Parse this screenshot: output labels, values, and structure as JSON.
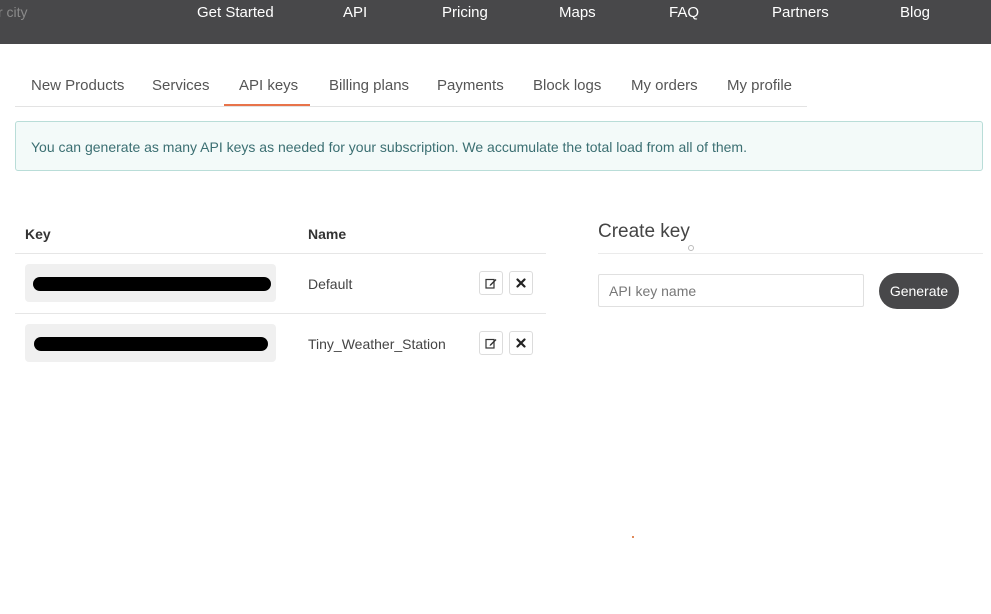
{
  "topbar": {
    "search_placeholder": "r city",
    "nav": [
      "Get Started",
      "API",
      "Pricing",
      "Maps",
      "FAQ",
      "Partners",
      "Blog"
    ]
  },
  "tabs": {
    "items": [
      "New Products",
      "Services",
      "API keys",
      "Billing plans",
      "Payments",
      "Block logs",
      "My orders",
      "My profile"
    ],
    "active": "API keys",
    "accent_color": "#e8734a"
  },
  "alert": {
    "text": "You can generate as many API keys as needed for your subscription. We accumulate the total load from all of them."
  },
  "keys_table": {
    "headers": {
      "key": "Key",
      "name": "Name"
    },
    "rows": [
      {
        "name": "Default",
        "key_redacted": true,
        "actions": [
          "edit-icon",
          "delete-icon"
        ]
      },
      {
        "name": "Tiny_Weather_Station",
        "key_redacted": true,
        "actions": [
          "edit-icon",
          "delete-icon"
        ]
      }
    ]
  },
  "create_key": {
    "title": "Create key",
    "input_placeholder": "API key name",
    "button_label": "Generate"
  }
}
